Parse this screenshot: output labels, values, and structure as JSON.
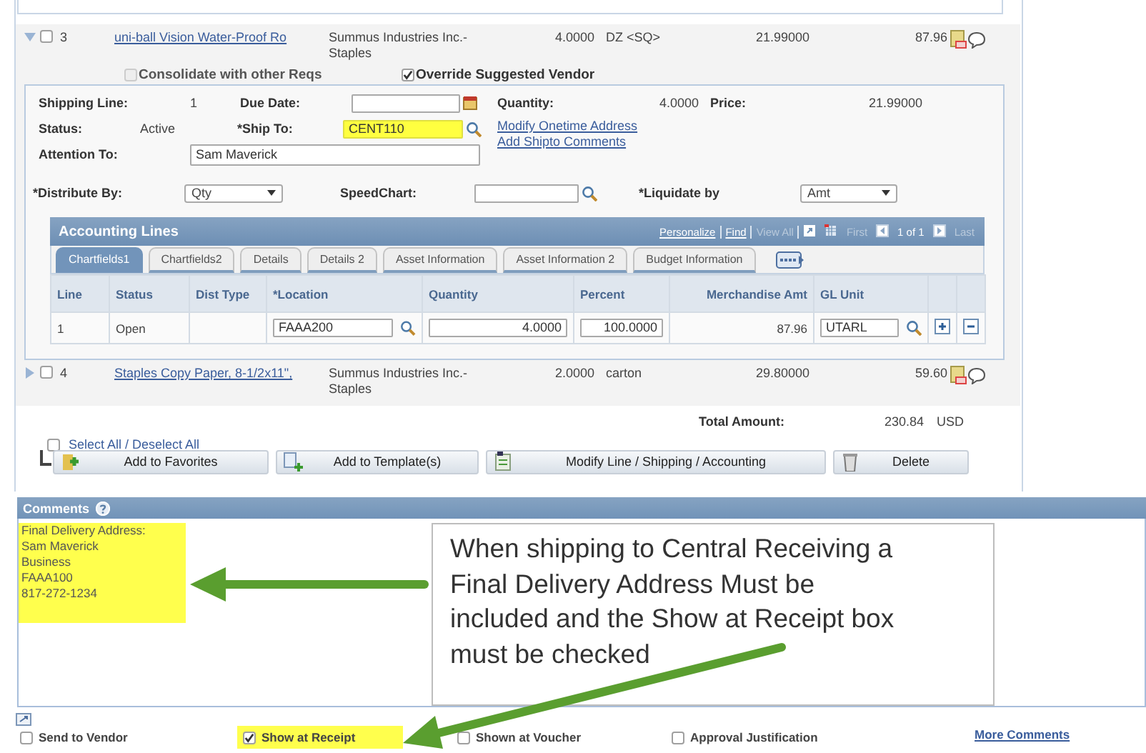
{
  "lines": [
    {
      "expanded": true,
      "selected": false,
      "number": "3",
      "description": "uni-ball Vision Water-Proof Ro",
      "vendor": "Summus Industries Inc.-\nStaples",
      "quantity": "4.0000",
      "uom": "DZ <SQ>",
      "price": "21.99000",
      "amount": "87.96",
      "options": [
        {
          "label": "Consolidate with other Reqs",
          "checked": false,
          "disabled": true
        },
        {
          "label": "Override Suggested Vendor",
          "checked": true,
          "disabled": false
        }
      ],
      "shipping": {
        "shipping_line_label": "Shipping Line:",
        "shipping_line": "1",
        "due_date_label": "Due Date:",
        "quantity_label": "Quantity:",
        "quantity": "4.0000",
        "price_label": "Price:",
        "price": "21.99000",
        "status_label": "Status:",
        "status": "Active",
        "ship_to_label": "*Ship To:",
        "ship_to": {
          "value": "CENT110",
          "highlighted": true
        },
        "links": [
          "Modify Onetime Address",
          "Add Shipto Comments"
        ],
        "attention_label": "Attention To:",
        "attention": "Sam Maverick",
        "distribute_label": "*Distribute By:",
        "distribute": "Qty",
        "speedchart_label": "SpeedChart:",
        "liquidate_label": "*Liquidate by",
        "liquidate": "Amt"
      },
      "accounting": {
        "title": "Accounting Lines",
        "nav": [
          {
            "kind": "link",
            "label": "Personalize",
            "separated": true
          },
          {
            "kind": "link",
            "label": "Find",
            "separated": true
          },
          {
            "kind": "disabled",
            "label": "View All",
            "separated": true
          },
          {
            "kind": "zoom"
          },
          {
            "kind": "download"
          },
          {
            "kind": "disabled",
            "label": "First",
            "separated": false
          },
          {
            "kind": "prev"
          },
          {
            "kind": "text",
            "label": "1 of 1",
            "separated": false
          },
          {
            "kind": "next"
          },
          {
            "kind": "disabled",
            "label": "Last",
            "separated": false
          }
        ],
        "tabs": [
          {
            "label": "Chartfields1",
            "selected": true
          },
          {
            "label": "Chartfields2",
            "selected": false
          },
          {
            "label": "Details",
            "selected": false
          },
          {
            "label": "Details 2",
            "selected": false
          },
          {
            "label": "Asset Information",
            "selected": false
          },
          {
            "label": "Asset Information 2",
            "selected": false
          },
          {
            "label": "Budget Information",
            "selected": false
          }
        ],
        "columns": [
          "Line",
          "Status",
          "Dist Type",
          "*Location",
          "Quantity",
          "Percent",
          "Merchandise Amt",
          "GL Unit"
        ],
        "rows": [
          {
            "line": "1",
            "status": "Open",
            "location": "FAAA200",
            "quantity": "4.0000",
            "percent": "100.0000",
            "merchandise_amt": "87.96",
            "gl_unit": "UTARL"
          }
        ]
      }
    },
    {
      "expanded": false,
      "selected": false,
      "number": "4",
      "description": "Staples Copy Paper, 8-1/2x11\",",
      "vendor": "Summus Industries Inc.-\nStaples",
      "quantity": "2.0000",
      "uom": "carton",
      "price": "29.80000",
      "amount": "59.60"
    }
  ],
  "select_all": {
    "label": "Select All / Deselect All",
    "checked": false
  },
  "total": {
    "label": "Total Amount:",
    "value": "230.84",
    "currency": "USD"
  },
  "actions": [
    {
      "kind": "favorites",
      "label": "Add to Favorites"
    },
    {
      "kind": "template",
      "label": "Add to Template(s)"
    },
    {
      "kind": "modify",
      "label": "Modify Line / Shipping / Accounting"
    },
    {
      "kind": "delete",
      "label": "Delete"
    }
  ],
  "comments": {
    "title": "Comments",
    "text": "Final Delivery Address:\nSam Maverick\nBusiness\nFAAA100\n817-272-1234",
    "highlighted": true,
    "options": [
      {
        "label": "Send to Vendor",
        "checked": false,
        "highlighted": false
      },
      {
        "label": "Show at Receipt",
        "checked": true,
        "highlighted": true
      },
      {
        "label": "Shown at Voucher",
        "checked": false,
        "highlighted": false
      },
      {
        "label": "Approval Justification",
        "checked": false,
        "highlighted": false
      }
    ],
    "more_link": "More Comments"
  },
  "callout": {
    "text": "When shipping to Central Receiving a\nFinal Delivery Address Must be\nincluded and the Show at Receipt box\nmust be checked"
  }
}
